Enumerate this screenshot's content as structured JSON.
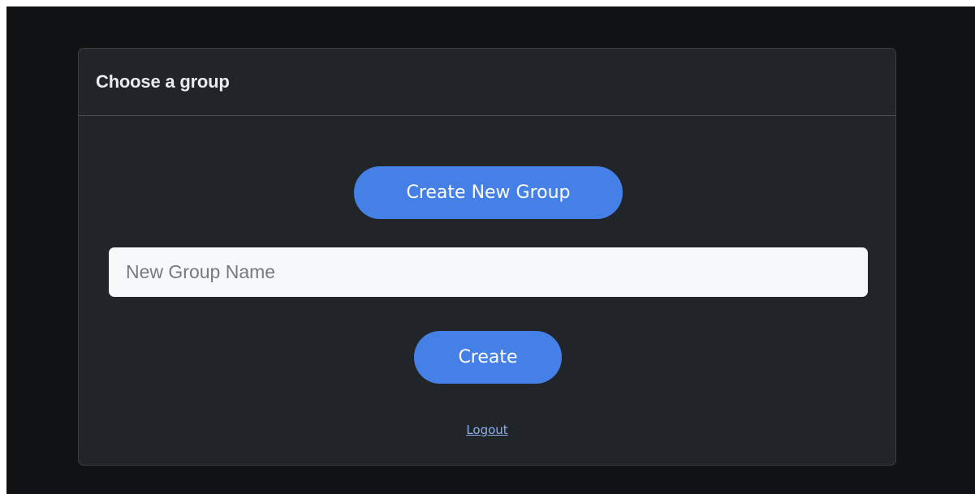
{
  "card": {
    "title": "Choose a group"
  },
  "actions": {
    "create_new_group_label": "Create New Group",
    "create_label": "Create",
    "logout_label": "Logout"
  },
  "group_name_input": {
    "placeholder": "New Group Name",
    "value": ""
  },
  "colors": {
    "page_background": "#111214",
    "card_background": "#212429",
    "accent": "#4580e6",
    "link": "#8fb0ea"
  }
}
